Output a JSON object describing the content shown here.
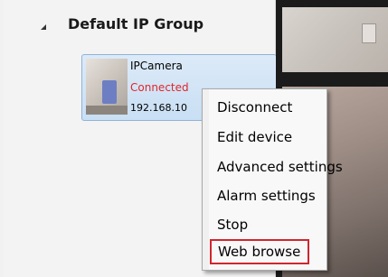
{
  "group": {
    "title": "Default IP Group"
  },
  "device": {
    "name": "IPCamera",
    "status": "Connected",
    "ip": "192.168.10"
  },
  "context_menu": {
    "items": [
      {
        "label": "Disconnect"
      },
      {
        "label": "Edit device"
      },
      {
        "label": "Advanced settings"
      },
      {
        "label": "Alarm settings"
      },
      {
        "label": "Stop"
      },
      {
        "label": "Web browse",
        "highlighted": true
      }
    ]
  },
  "colors": {
    "status_connected": "#e0262a",
    "highlight_box": "#d0262e",
    "card_selected": "#c9dff4"
  }
}
